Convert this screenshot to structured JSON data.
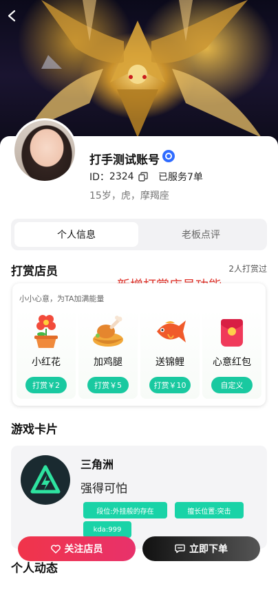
{
  "header": {
    "back_icon": "chevron-left-icon"
  },
  "profile": {
    "name": "打手测试账号",
    "verified_icon": "verified-badge-icon",
    "id_label": "ID：",
    "id_value": "2324",
    "copy_icon": "copy-icon",
    "served": "已服务7单",
    "info": "15岁，虎，摩羯座"
  },
  "tabs": [
    {
      "label": "个人信息",
      "active": true
    },
    {
      "label": "老板点评",
      "active": false
    }
  ],
  "tip": {
    "title": "打赏店员",
    "count": "2人打赏过",
    "annotation": "新增打赏店员功能",
    "subtitle": "小小心意，为TA加满能量",
    "gifts": [
      {
        "name": "小红花",
        "button": "打赏￥2",
        "icon": "flower-pot-icon"
      },
      {
        "name": "加鸡腿",
        "button": "打赏￥5",
        "icon": "chicken-leg-icon"
      },
      {
        "name": "送锦鲤",
        "button": "打赏￥10",
        "icon": "koi-fish-icon"
      },
      {
        "name": "心意红包",
        "button": "自定义",
        "icon": "red-envelope-icon"
      }
    ]
  },
  "game": {
    "section_title": "游戏卡片",
    "name": "三角洲",
    "desc": "强得可怕",
    "logo_icon": "delta-force-logo-icon",
    "tags": [
      "段位:外挂般的存在",
      "擅长位置:突击",
      "kda:999"
    ]
  },
  "activity": {
    "title": "个人动态"
  },
  "actions": {
    "follow": "关注店员",
    "follow_icon": "heart-icon",
    "order": "立即下单",
    "order_icon": "message-icon"
  },
  "colors": {
    "accent": "#19c9a0",
    "follow": "#ee3350",
    "verified": "#2f6bff",
    "annotation": "#e0362e"
  }
}
